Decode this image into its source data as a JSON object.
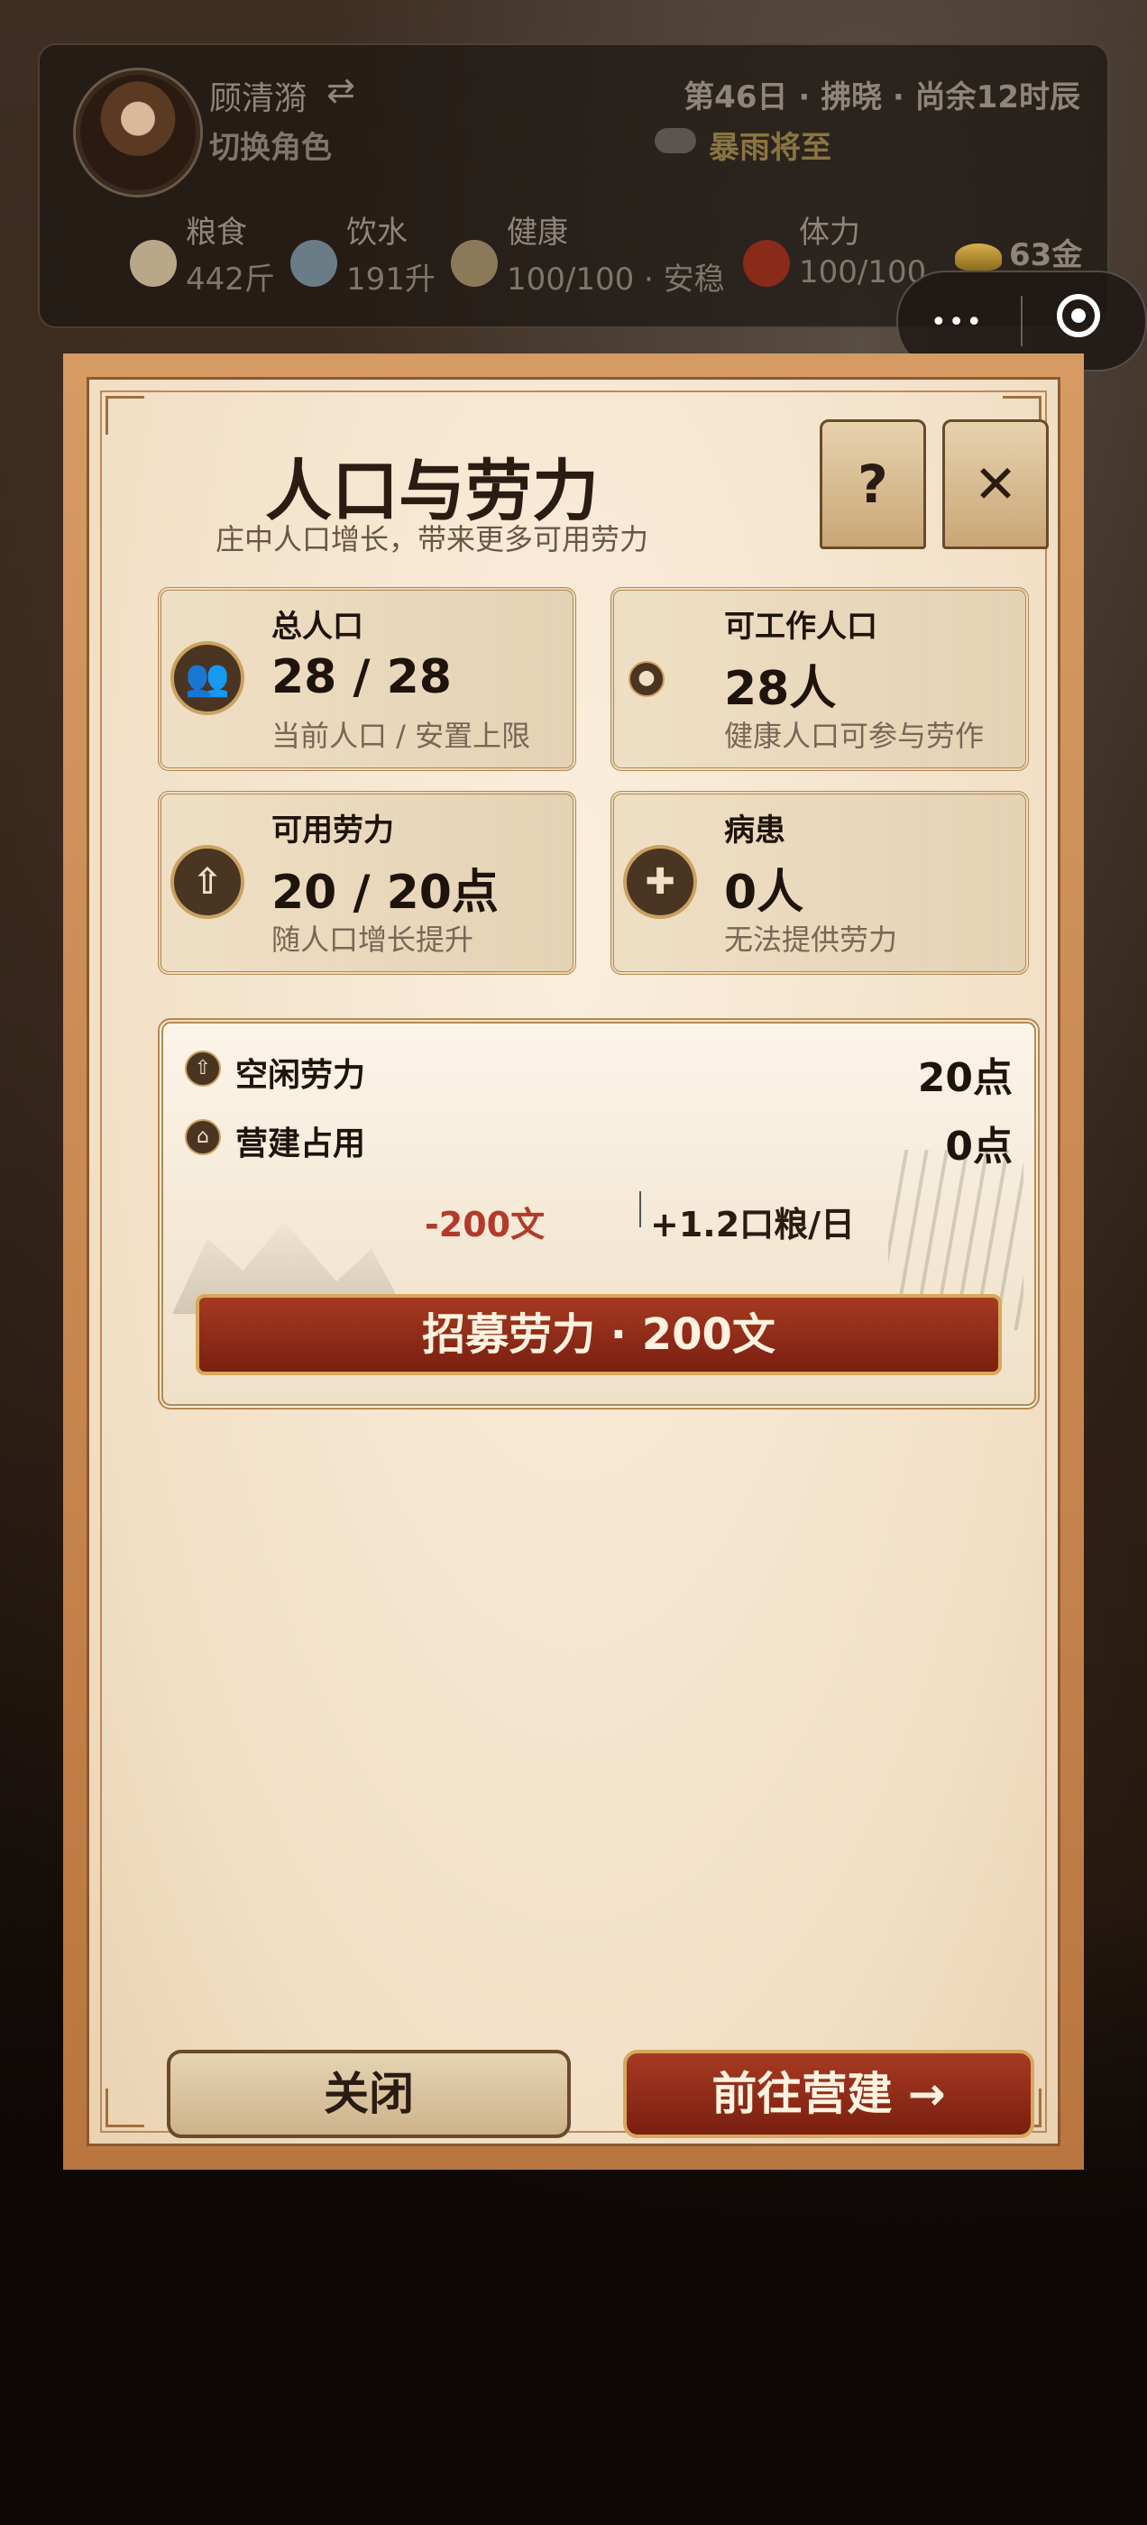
{
  "hud": {
    "name": "顾清漪",
    "swap_glyph": "⇄",
    "switch_label": "切换角色",
    "day_info": "第46日 · 拂晓 · 尚余12时辰",
    "weather": "暴雨将至",
    "resources": [
      {
        "label": "粮食",
        "value": "442斤",
        "icon": "grain-icon",
        "color": "#b9a78a"
      },
      {
        "label": "饮水",
        "value": "191升",
        "icon": "water-drop-icon",
        "color": "#6a7c86"
      },
      {
        "label": "健康",
        "value": "100/100 · 安稳",
        "icon": "herb-icon",
        "color": "#8a7a5a"
      },
      {
        "label": "体力",
        "value": "100/100",
        "icon": "stamina-icon",
        "color": "#8a2a18"
      }
    ],
    "gold": "63金"
  },
  "capsule": {
    "more": "•••"
  },
  "modal": {
    "title": "人口与劳力",
    "subtitle": "庄中人口增长，带来更多可用劳力",
    "help_label": "?",
    "close_label": "✕",
    "stats": [
      {
        "label": "总人口",
        "value": "28 / 28",
        "sub": "当前人口 / 安置上限",
        "icon": "villagers-icon",
        "glyph": "👥"
      },
      {
        "label": "可工作人口",
        "value": "28人",
        "sub": "健康人口可参与劳作",
        "icon": "worker-icon",
        "glyph": "●"
      },
      {
        "label": "可用劳力",
        "value": "20 / 20点",
        "sub": "随人口增长提升",
        "icon": "labor-up-icon",
        "glyph": "⇧"
      },
      {
        "label": "病患",
        "value": "0人",
        "sub": "无法提供劳力",
        "icon": "patient-icon",
        "glyph": "✚"
      }
    ],
    "labor": {
      "idle_label": "空闲劳力",
      "idle_value": "20点",
      "build_label": "营建占用",
      "build_value": "0点",
      "cost": "-200文",
      "upkeep": "+1.2口粮/日",
      "recruit_label": "招募劳力 · 200文"
    },
    "close_button": "关闭",
    "go_button": "前往营建 →"
  }
}
